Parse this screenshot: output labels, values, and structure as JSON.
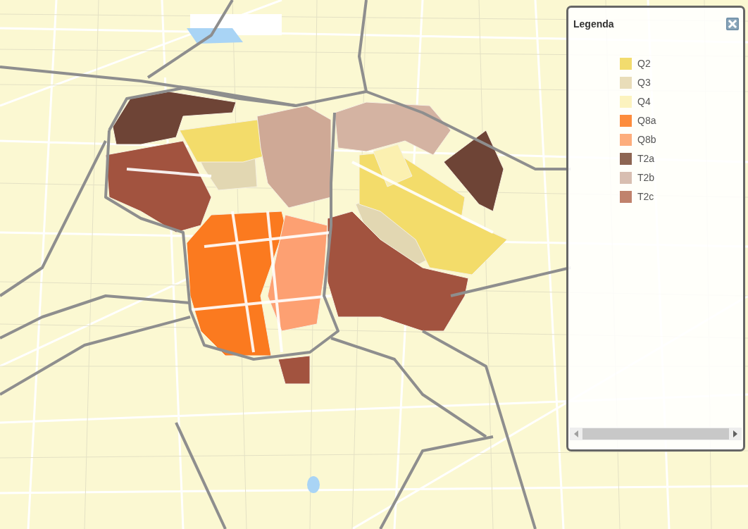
{
  "legend": {
    "title": "Legenda",
    "items": [
      {
        "label": "Q2",
        "color": "#f2dc6e"
      },
      {
        "label": "Q3",
        "color": "#e9ddb9"
      },
      {
        "label": "Q4",
        "color": "#fcf3bf"
      },
      {
        "label": "Q8a",
        "color": "#fd8c3d"
      },
      {
        "label": "Q8b",
        "color": "#fdad7c"
      },
      {
        "label": "T2a",
        "color": "#8d6552"
      },
      {
        "label": "T2b",
        "color": "#d8beb1"
      },
      {
        "label": "T2c",
        "color": "#c0826c"
      }
    ]
  }
}
